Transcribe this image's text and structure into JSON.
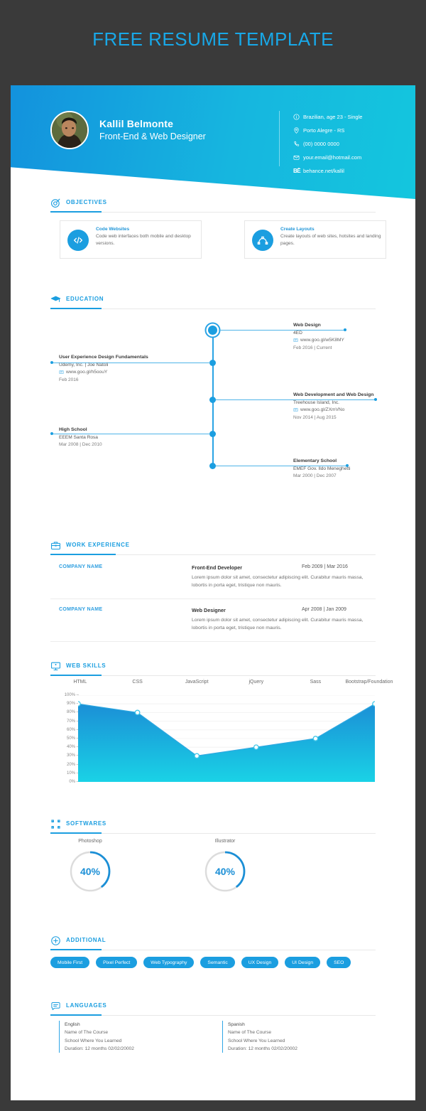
{
  "page": {
    "title": "FREE RESUME TEMPLATE",
    "accent": "#1b9ee0",
    "background": "#3a3a3a"
  },
  "header": {
    "name": "Kallil Belmonte",
    "role": "Front-End & Web Designer",
    "contacts": [
      {
        "icon": "info-circle-icon",
        "text": "Brazilian, age 23 - Single"
      },
      {
        "icon": "location-pin-icon",
        "text": "Porto Alegre - RS"
      },
      {
        "icon": "phone-icon",
        "text": "(00) 0000 0000"
      },
      {
        "icon": "envelope-icon",
        "text": "your.email@hotmail.com"
      },
      {
        "icon": "behance-icon",
        "text": "behance.net/kallil"
      }
    ]
  },
  "objectives": {
    "label": "OBJECTIVES",
    "icon": "target-icon",
    "cards": [
      {
        "icon": "code-brackets-icon",
        "title": "Code Websites",
        "desc": "Code web interfaces both mobile and desktop versions."
      },
      {
        "icon": "pen-tool-icon",
        "title": "Create Layouts",
        "desc": "Create layouts of web sites, hotsites and landing pages."
      }
    ]
  },
  "education": {
    "label": "EDUCATION",
    "icon": "graduation-cap-icon",
    "items": [
      {
        "title": "Web Design",
        "sub": "4ED",
        "link": "www.goo.gl/w5K8MY",
        "date": "Feb 2016  |  Current",
        "side": "right"
      },
      {
        "title": "User Experience Design Fundamentals",
        "sub": "Udemy, Inc. | Joe Natoli",
        "link": "www.goo.gl/h5oouY",
        "date": "Feb 2016",
        "side": "left"
      },
      {
        "title": "Web Development and Web Design",
        "sub": "Treehouse Island, Inc.",
        "link": "www.goo.gl/ZXmVNo",
        "date": "Nov 2014  |  Aug 2015",
        "side": "right"
      },
      {
        "title": "High School",
        "sub": "EEEM Santa Rosa",
        "link": "",
        "date": "Mar 2008 | Dec 2010",
        "side": "left"
      },
      {
        "title": "Elementary School",
        "sub": "EMEF Gov. Ildo Meneghetti",
        "link": "",
        "date": "Mar 2000 |  Dec 2007",
        "side": "right"
      }
    ]
  },
  "work": {
    "label": "WORK EXPERIENCE",
    "icon": "briefcase-icon",
    "rows": [
      {
        "company": "COMPANY NAME",
        "role": "Front-End Developer",
        "date": "Feb 2009 | Mar 2016",
        "desc": "Lorem ipsum dolor sit amet, consectetur adipiscing elit. Curabitur mauris massa, lobortis in porta eget, tristique non mauris."
      },
      {
        "company": "COMPANY NAME",
        "role": "Web Designer",
        "date": "Apr 2008 | Jan 2009",
        "desc": "Lorem ipsum dolor sit amet, consectetur adipiscing elit. Curabitur mauris massa, lobortis in porta eget, tristique non mauris."
      }
    ]
  },
  "skills": {
    "label": "WEB SKILLS",
    "icon": "monitor-icon"
  },
  "chart_data": {
    "type": "area",
    "title": "WEB SKILLS",
    "categories": [
      "HTML",
      "CSS",
      "JavaScript",
      "jQuery",
      "Sass",
      "Bootstrap/Foundation"
    ],
    "values": [
      90,
      80,
      30,
      40,
      50,
      90
    ],
    "ylabel": "",
    "xlabel": "",
    "ylim": [
      0,
      100
    ],
    "yticks": [
      "0%",
      "10%",
      "20%",
      "30%",
      "40%",
      "50%",
      "60%",
      "70%",
      "80%",
      "90%",
      "100%"
    ],
    "grid": true,
    "legend": "none",
    "fill_top_color": "#1b8fd6",
    "fill_bottom_color": "#1ad2e6"
  },
  "softwares": {
    "label": "SOFTWARES",
    "icon": "transform-box-icon",
    "items": [
      {
        "name": "Photoshop",
        "percent": 40,
        "display": "40%"
      },
      {
        "name": "Illustrator",
        "percent": 40,
        "display": "40%"
      }
    ]
  },
  "additional": {
    "label": "ADDITIONAL",
    "icon": "plus-circle-icon",
    "tags": [
      "Mobile First",
      "Pixel Perfect",
      "Web Typography",
      "Semantic",
      "UX Design",
      "UI Design",
      "SEO"
    ]
  },
  "languages": {
    "label": "LANGUAGES",
    "icon": "speech-bubble-icon",
    "items": [
      {
        "name": "English",
        "course": "Name of The Course",
        "school": "School Where You Learned",
        "duration": "Duration: 12 months     02/02/20002"
      },
      {
        "name": "Spanish",
        "course": "Name of The Course",
        "school": "School Where You Learned",
        "duration": "Duration: 12 months     02/02/20002"
      }
    ]
  }
}
